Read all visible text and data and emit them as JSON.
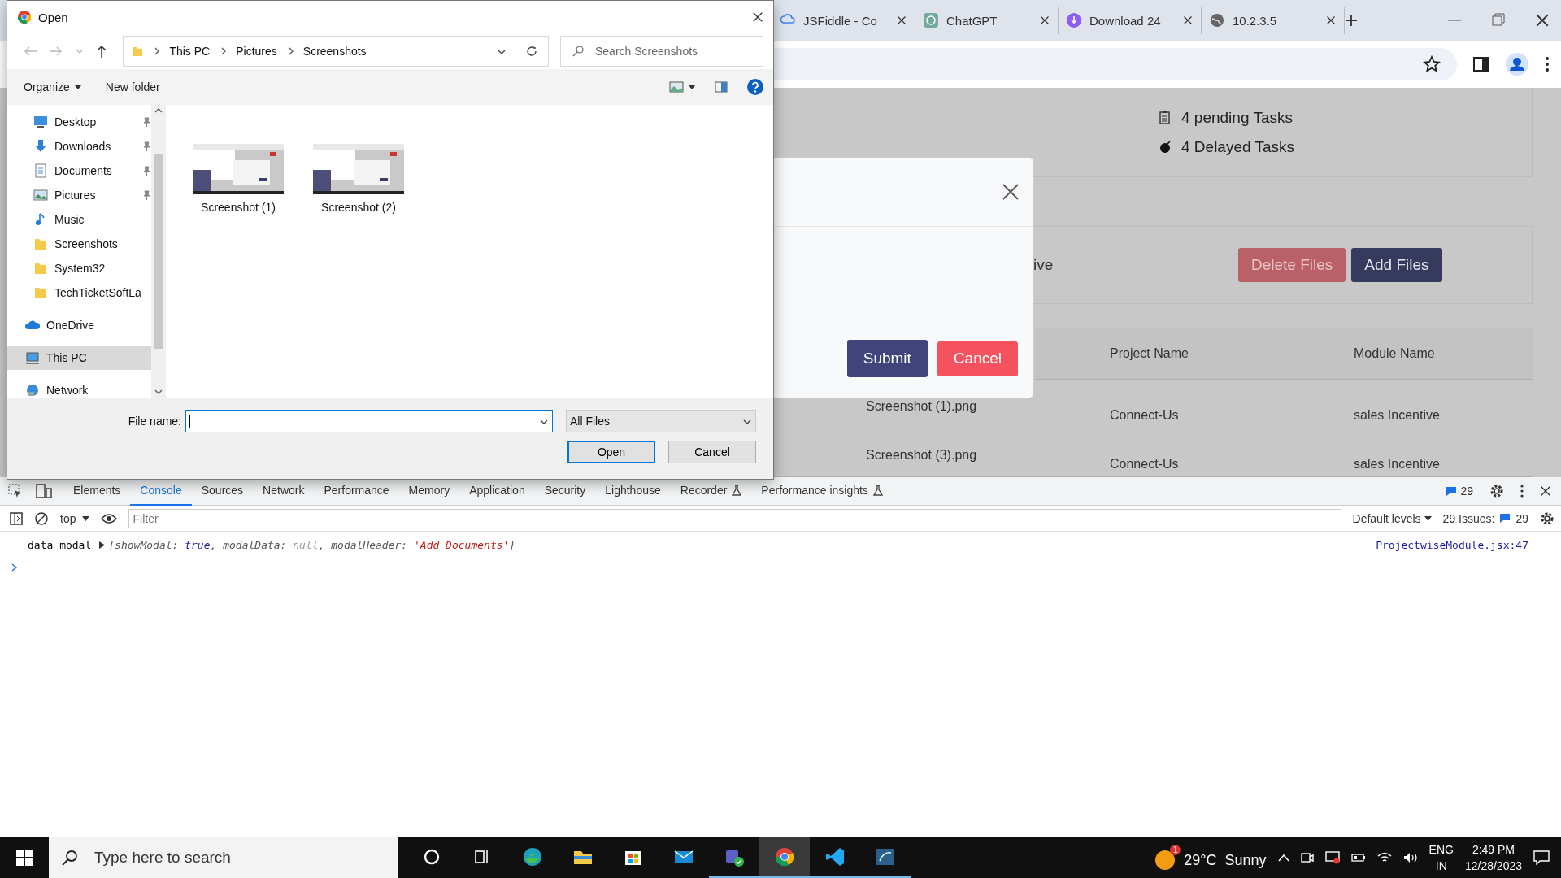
{
  "browser": {
    "tabs": [
      {
        "title": "JSFiddle - Co",
        "kind": "cloud",
        "selected": false
      },
      {
        "title": "ChatGPT",
        "kind": "knot",
        "selected": false
      },
      {
        "title": "Download 24",
        "kind": "download",
        "selected": false
      },
      {
        "title": "10.2.3.5",
        "kind": "globe",
        "selected": false
      }
    ]
  },
  "page": {
    "stats": [
      {
        "text": "4 pending Tasks",
        "kind": "pending"
      },
      {
        "text": "4 Delayed Tasks",
        "kind": "delayed"
      }
    ],
    "section_text": "ive",
    "actions": [
      {
        "label": "Delete Files",
        "kind": "danger"
      },
      {
        "label": "Add Files",
        "kind": "primary"
      }
    ],
    "table": {
      "columns": [
        "Project Name",
        "Module Name"
      ],
      "rows": [
        {
          "file": "Screenshot (1).png",
          "project": "Connect-Us",
          "module": "sales Incentive"
        },
        {
          "file": "Screenshot (3).png",
          "project": "Connect-Us",
          "module": "sales Incentive"
        }
      ]
    }
  },
  "modal": {
    "buttons": [
      {
        "label": "Submit",
        "kind": "primary"
      },
      {
        "label": "Cancel",
        "kind": "danger"
      }
    ]
  },
  "file_dialog": {
    "title": "Open",
    "path": [
      "This PC",
      "Pictures",
      "Screenshots"
    ],
    "search_placeholder": "Search Screenshots",
    "toolbar": [
      "Organize",
      "New folder"
    ],
    "nav_items": [
      {
        "label": "Desktop",
        "kind": "desktop",
        "pinned": true,
        "selected": false
      },
      {
        "label": "Downloads",
        "kind": "downloads",
        "pinned": true,
        "selected": false
      },
      {
        "label": "Documents",
        "kind": "documents",
        "pinned": true,
        "selected": false
      },
      {
        "label": "Pictures",
        "kind": "pictures",
        "pinned": true,
        "selected": false
      },
      {
        "label": "Music",
        "kind": "music",
        "pinned": false,
        "selected": false
      },
      {
        "label": "Screenshots",
        "kind": "folder",
        "pinned": false,
        "selected": false
      },
      {
        "label": "System32",
        "kind": "folder",
        "pinned": false,
        "selected": false
      },
      {
        "label": "TechTicketSoftLa",
        "kind": "folder",
        "pinned": false,
        "selected": false
      },
      {
        "label": "OneDrive",
        "kind": "onedrive",
        "pinned": false,
        "selected": false
      },
      {
        "label": "This PC",
        "kind": "pc",
        "pinned": false,
        "selected": true
      },
      {
        "label": "Network",
        "kind": "network",
        "pinned": false,
        "selected": false
      }
    ],
    "files": [
      {
        "name": "Screenshot (1)",
        "kind": "picture"
      },
      {
        "name": "Screenshot (2)",
        "kind": "picture"
      }
    ],
    "file_name_label": "File name:",
    "file_type": "All Files",
    "buttons": [
      {
        "label": "Open",
        "kind": "default"
      },
      {
        "label": "Cancel",
        "kind": "normal"
      }
    ]
  },
  "devtools": {
    "tabs": [
      {
        "label": "Elements",
        "selected": false,
        "experimental": false
      },
      {
        "label": "Console",
        "selected": true,
        "experimental": false
      },
      {
        "label": "Sources",
        "selected": false,
        "experimental": false
      },
      {
        "label": "Network",
        "selected": false,
        "experimental": false
      },
      {
        "label": "Performance",
        "selected": false,
        "experimental": false
      },
      {
        "label": "Memory",
        "selected": false,
        "experimental": false
      },
      {
        "label": "Application",
        "selected": false,
        "experimental": false
      },
      {
        "label": "Security",
        "selected": false,
        "experimental": false
      },
      {
        "label": "Lighthouse",
        "selected": false,
        "experimental": false
      },
      {
        "label": "Recorder",
        "selected": false,
        "experimental": true
      },
      {
        "label": "Performance insights",
        "selected": false,
        "experimental": true
      }
    ],
    "messages_badge": "29",
    "context": "top",
    "filter_placeholder": "Filter",
    "levels": "Default levels",
    "issues_label": "29 Issues:",
    "issues_count": "29",
    "console": [
      {
        "label": "data modal",
        "parts": [
          {
            "text": "{showModal: ",
            "kind": "key"
          },
          {
            "text": "true",
            "kind": "keyword"
          },
          {
            "text": ", modalData: ",
            "kind": "key"
          },
          {
            "text": "null",
            "kind": "null"
          },
          {
            "text": ", modalHeader: ",
            "kind": "key"
          },
          {
            "text": "'Add Documents'",
            "kind": "string"
          },
          {
            "text": "}",
            "kind": "key"
          }
        ],
        "source": "ProjectwiseModule.jsx:47"
      }
    ]
  },
  "taskbar": {
    "search_placeholder": "Type here to search",
    "apps": [
      {
        "kind": "cortana",
        "running": false,
        "selected": false
      },
      {
        "kind": "taskview",
        "running": false,
        "selected": false
      },
      {
        "kind": "edge",
        "running": false,
        "selected": false
      },
      {
        "kind": "explorer",
        "running": false,
        "selected": false
      },
      {
        "kind": "store",
        "running": false,
        "selected": false
      },
      {
        "kind": "mail",
        "running": false,
        "selected": false
      },
      {
        "kind": "teams",
        "running": true,
        "selected": false
      },
      {
        "kind": "chrome",
        "running": true,
        "selected": true
      },
      {
        "kind": "vscode",
        "running": true,
        "selected": false
      },
      {
        "kind": "database",
        "running": true,
        "selected": false
      }
    ],
    "weather": {
      "badge": "1",
      "temperature": "29°C",
      "condition": "Sunny"
    },
    "language": [
      "ENG",
      "IN"
    ],
    "time": "2:49 PM",
    "date": "12/28/2023"
  }
}
